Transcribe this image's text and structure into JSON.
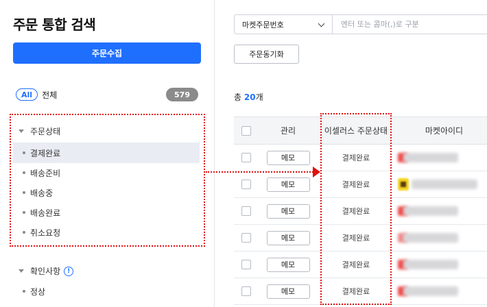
{
  "sidebar": {
    "title": "주문 통합 검색",
    "collect_button": "주문수집",
    "all": {
      "pill": "All",
      "label": "전체",
      "count": "579"
    },
    "status_group": {
      "header": "주문상태",
      "items": [
        {
          "label": "결제완료",
          "selected": true
        },
        {
          "label": "배송준비"
        },
        {
          "label": "배송중"
        },
        {
          "label": "배송완료"
        },
        {
          "label": "취소요청"
        }
      ]
    },
    "check_group": {
      "header": "확인사항",
      "info_icon": "!",
      "items": [
        {
          "label": "정상"
        }
      ]
    }
  },
  "main": {
    "search": {
      "select_value": "마켓주문번호",
      "placeholder": "엔터 또는 콤마(,)로 구분"
    },
    "sync_button": "주문동기화",
    "total": {
      "prefix": "총 ",
      "count": "20",
      "suffix": "개"
    },
    "table": {
      "headers": {
        "manage": "관리",
        "status": "이셀러스 주문상태",
        "market_id": "마켓아이디"
      },
      "rows": [
        {
          "memo": "메모",
          "status": "결제완료"
        },
        {
          "memo": "메모",
          "status": "결제완료"
        },
        {
          "memo": "메모",
          "status": "결제완료"
        },
        {
          "memo": "메모",
          "status": "결제완료"
        },
        {
          "memo": "메모",
          "status": "결제완료"
        },
        {
          "memo": "메모",
          "status": "결제완료"
        }
      ]
    }
  },
  "colors": {
    "accent": "#1f6fff",
    "annotation": "#e01010",
    "count_badge": "#8b8b8b"
  },
  "icons": [
    "caret-down-icon",
    "chevron-down-icon",
    "info-icon",
    "checkbox-icon"
  ]
}
